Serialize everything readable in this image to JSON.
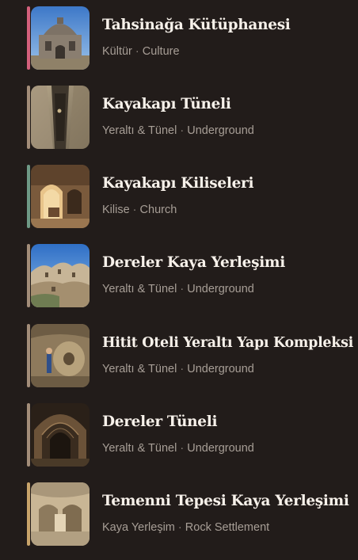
{
  "items": [
    {
      "title": "Tahsinağa Kütüphanesi",
      "category_tr": "Kültür",
      "category_en": "Culture",
      "separator": " · ",
      "accent_color": "#d4607c",
      "thumb_icon": "domed-stone-building-photo"
    },
    {
      "title": "Kayakapı Tüneli",
      "category_tr": "Yeraltı & Tünel",
      "category_en": "Underground",
      "separator": " · ",
      "accent_color": "#a38d79",
      "thumb_icon": "rock-tunnel-photo"
    },
    {
      "title": "Kayakapı Kiliseleri",
      "category_tr": "Kilise",
      "category_en": "Church",
      "separator": " · ",
      "accent_color": "#6f9a86",
      "thumb_icon": "rock-cut-church-photo"
    },
    {
      "title": "Dereler Kaya Yerleşimi",
      "category_tr": "Yeraltı & Tünel",
      "category_en": "Underground",
      "separator": " · ",
      "accent_color": "#a38d79",
      "thumb_icon": "rock-settlement-landscape-photo"
    },
    {
      "title": "Hitit Oteli Yeraltı Yapı Kompleksi",
      "category_tr": "Yeraltı & Tünel",
      "category_en": "Underground",
      "separator": " · ",
      "accent_color": "#a38d79",
      "thumb_icon": "underground-millstone-door-photo"
    },
    {
      "title": "Dereler Tüneli",
      "category_tr": "Yeraltı & Tünel",
      "category_en": "Underground",
      "separator": " · ",
      "accent_color": "#a38d79",
      "thumb_icon": "arched-tunnel-photo"
    },
    {
      "title": "Temenni Tepesi Kaya Yerleşimi",
      "category_tr": "Kaya Yerleşim",
      "category_en": "Rock Settlement",
      "separator": " · ",
      "accent_color": "#c9a46a",
      "thumb_icon": "carved-rock-chamber-photo"
    }
  ]
}
